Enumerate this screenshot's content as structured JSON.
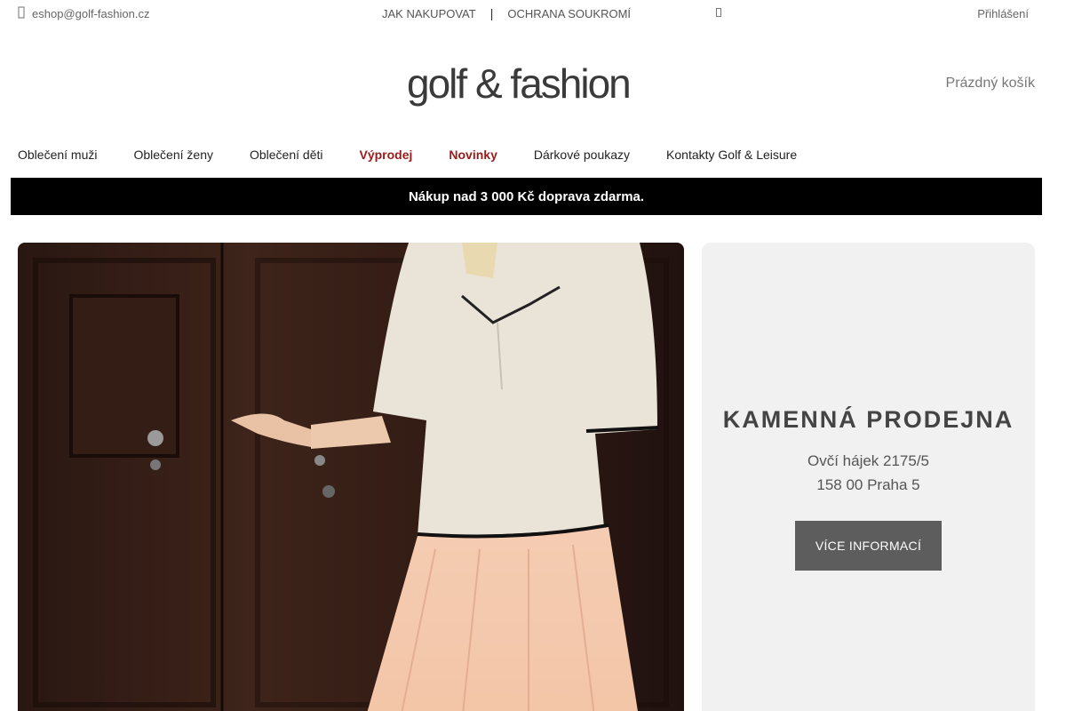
{
  "topbar": {
    "email": "eshop@golf-fashion.cz",
    "email_icon": "envelope-icon",
    "links": [
      "JAK NAKUPOVAT",
      "OCHRANA SOUKROMÍ"
    ],
    "separator": "|",
    "search_icon": "search-icon",
    "login": "Přihlášení"
  },
  "logo": {
    "text": "golf & fashion"
  },
  "cart": {
    "label": "Prázdný košík"
  },
  "nav": {
    "items": [
      "Oblečení muži",
      "Oblečení ženy",
      "Oblečení děti",
      "Výprodej",
      "Novinky",
      "Dárkové poukazy",
      "Kontakty Golf & Leisure"
    ]
  },
  "banner": {
    "text": "Nákup nad 3 000 Kč doprava zdarma."
  },
  "store": {
    "title": "KAMENNÁ PRODEJNA",
    "address_line1": "Ovčí hájek 2175/5",
    "address_line2": "158 00 Praha 5",
    "button": "VÍCE INFORMACÍ"
  },
  "colors": {
    "accent_sale": "#9b1b1b",
    "banner_bg": "#000000",
    "button_bg": "#5d5d5d",
    "card_bg": "#f1f1f1"
  }
}
